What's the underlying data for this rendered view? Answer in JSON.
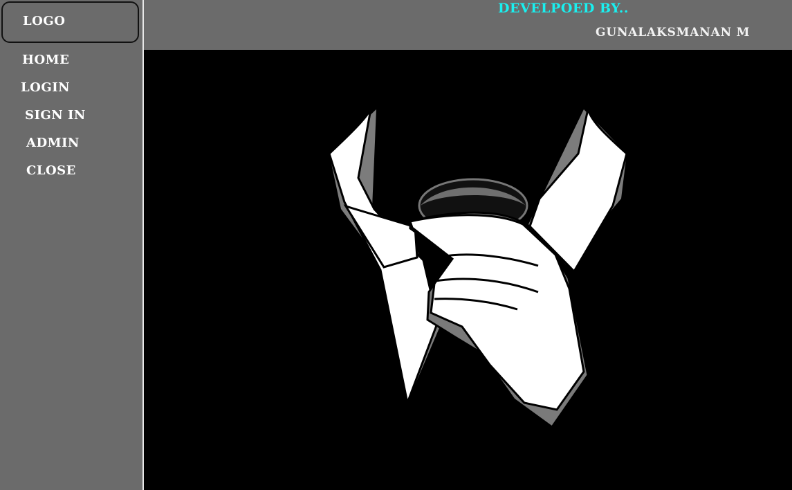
{
  "sidebar": {
    "logo": "LOGO",
    "items": [
      {
        "label": "HOME"
      },
      {
        "label": "LOGIN"
      },
      {
        "label": "SIGN IN"
      },
      {
        "label": "ADMIN"
      },
      {
        "label": "CLOSE"
      }
    ]
  },
  "header": {
    "developed_by": "DEVELPOED BY..",
    "developer": "GUNALAKSMANAN M"
  },
  "main": {
    "image": "suit-collar-tie-hand-illustration"
  },
  "colors": {
    "panel": "#6b6b6b",
    "background": "#000000",
    "accent": "#19f0f0",
    "text": "#ffffff"
  }
}
